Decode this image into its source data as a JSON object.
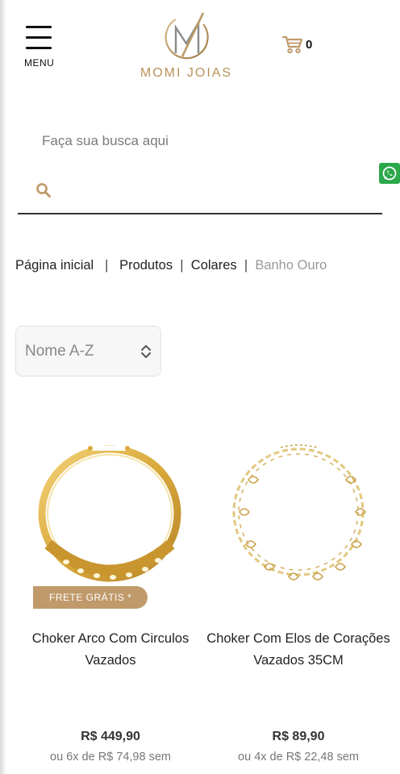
{
  "header": {
    "menu_label": "MENU",
    "logo_text": "MOMI JOIAS",
    "cart_count": "0"
  },
  "search": {
    "title": "Faça sua busca aqui",
    "placeholder": "",
    "value": ""
  },
  "breadcrumb": {
    "items": [
      "Página inicial",
      "Produtos",
      "Colares"
    ],
    "current": "Banho Ouro",
    "separators": [
      "|",
      "|",
      "|"
    ]
  },
  "sort": {
    "selected": "Nome A-Z"
  },
  "products": [
    {
      "name": "Choker Arco Com Circulos Vazados",
      "price": "R$ 449,90",
      "installments": "ou 6x de R$ 74,98 sem",
      "badge": "FRETE GRÁTIS *"
    },
    {
      "name": "Choker Com Elos de Corações Vazados 35CM",
      "price": "R$ 89,90",
      "installments": "ou 4x de R$ 22,48 sem",
      "badge": ""
    }
  ],
  "colors": {
    "accent_gold": "#c09a6b",
    "logo_gold": "#b8935a",
    "whatsapp_green": "#2aa84a"
  },
  "icons": [
    "menu-icon",
    "cart-icon",
    "search-icon",
    "whatsapp-icon",
    "sort-arrows-icon"
  ]
}
